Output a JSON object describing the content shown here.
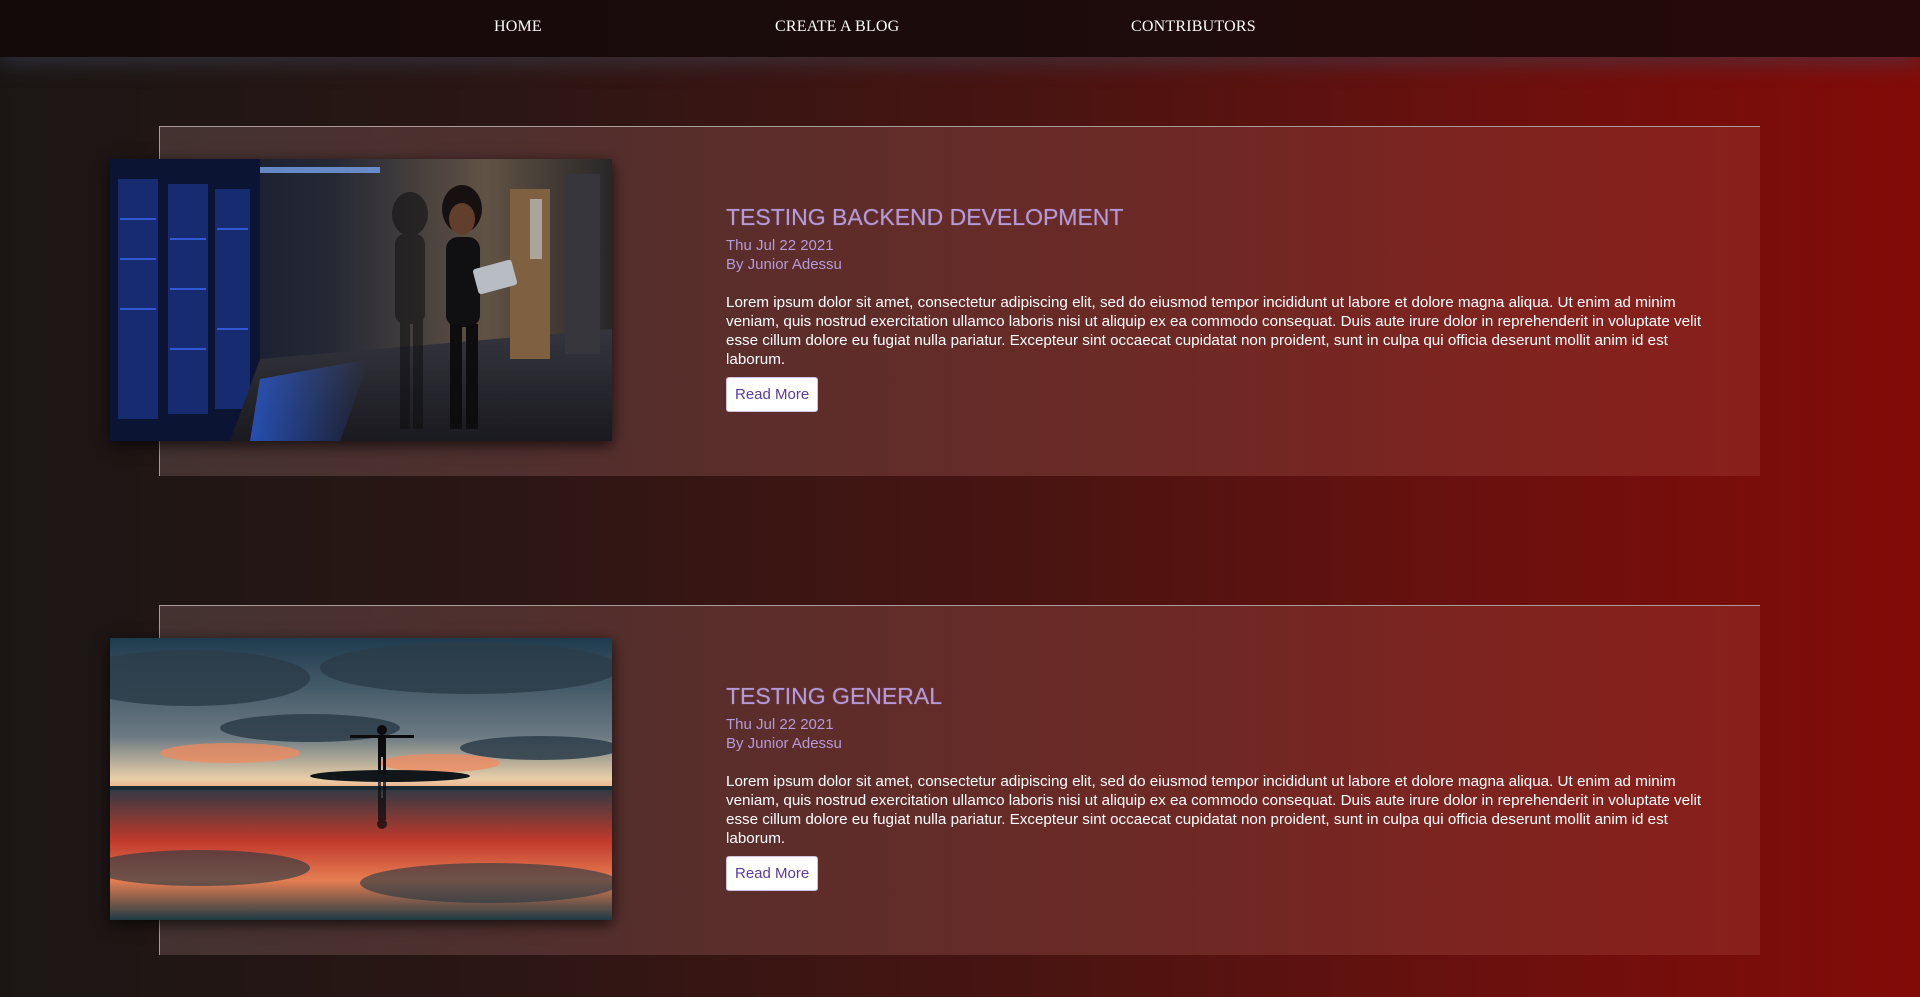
{
  "nav": {
    "home": "HOME",
    "create": "CREATE A BLOG",
    "contributors": "CONTRIBUTORS"
  },
  "posts": [
    {
      "title": "TESTING BACKEND DEVELOPMENT",
      "date": "Thu Jul 22 2021",
      "author": "By Junior Adessu",
      "body": "Lorem ipsum dolor sit amet, consectetur adipiscing elit, sed do eiusmod tempor incididunt ut labore et dolore magna aliqua. Ut enim ad minim veniam, quis nostrud exercitation ullamco laboris nisi ut aliquip ex ea commodo consequat. Duis aute irure dolor in reprehenderit in voluptate velit esse cillum dolore eu fugiat nulla pariatur. Excepteur sint occaecat cupidatat non proident, sunt in culpa qui officia deserunt mollit anim id est laborum.",
      "button": "Read More",
      "image": "photo-server-room-woman-with-laptop"
    },
    {
      "title": "TESTING GENERAL",
      "date": "Thu Jul 22 2021",
      "author": "By Junior Adessu",
      "body": "Lorem ipsum dolor sit amet, consectetur adipiscing elit, sed do eiusmod tempor incididunt ut labore et dolore magna aliqua. Ut enim ad minim veniam, quis nostrud exercitation ullamco laboris nisi ut aliquip ex ea commodo consequat. Duis aute irure dolor in reprehenderit in voluptate velit esse cillum dolore eu fugiat nulla pariatur. Excepteur sint occaecat cupidatat non proident, sunt in culpa qui officia deserunt mollit anim id est laborum.",
      "button": "Read More",
      "image": "photo-sunset-person-silhouette-reflection"
    }
  ],
  "colors": {
    "accent": "#b69ad8",
    "button_text": "#5b3a9a",
    "nav_bg": "#160a0a"
  }
}
